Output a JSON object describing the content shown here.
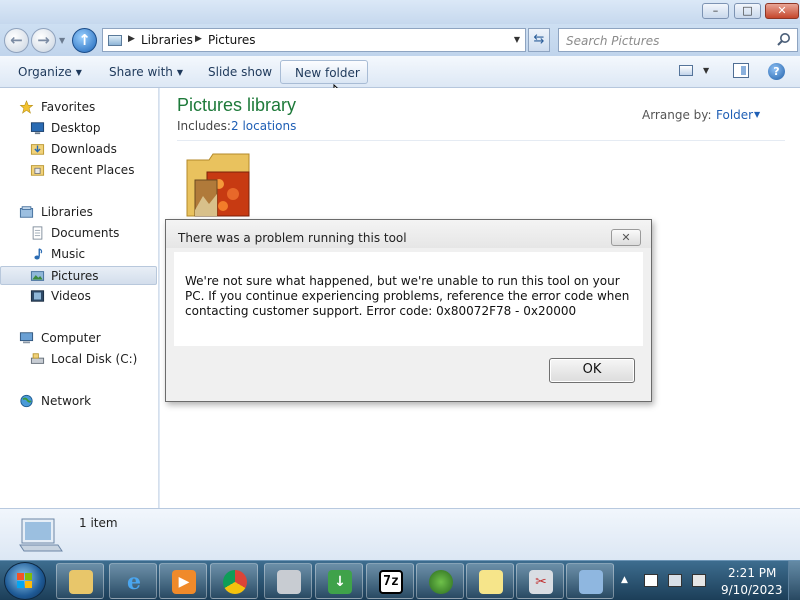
{
  "window": {
    "minimize_label": "–",
    "maximize_label": "□",
    "close_label": "✕"
  },
  "address": {
    "breadcrumb": [
      "Libraries",
      "Pictures"
    ],
    "search_placeholder": "Search Pictures"
  },
  "toolbar": {
    "organize": "Organize",
    "share_with": "Share with",
    "slide_show": "Slide show",
    "new_folder": "New folder"
  },
  "nav": {
    "favorites": "Favorites",
    "desktop": "Desktop",
    "downloads": "Downloads",
    "recent_places": "Recent Places",
    "libraries": "Libraries",
    "documents": "Documents",
    "music": "Music",
    "pictures": "Pictures",
    "videos": "Videos",
    "computer": "Computer",
    "local_disk": "Local Disk (C:)",
    "network": "Network"
  },
  "content": {
    "title": "Pictures library",
    "includes_label": "Includes:",
    "locations_link": "2 locations",
    "arrange_label": "Arrange by:",
    "arrange_value": "Folder"
  },
  "details": {
    "item_count": "1 item"
  },
  "dialog": {
    "title": "There was a problem running this tool",
    "message": "We're not sure what happened, but we're unable to run this tool on your PC. If you continue experiencing problems, reference the error code when contacting customer support. Error code: 0x80072F78 - 0x20000",
    "ok_label": "OK"
  },
  "taskbar": {
    "apps": [
      "windows-explorer",
      "internet-explorer",
      "media-player",
      "chrome",
      "scanner",
      "download-tool",
      "7zip",
      "media-creation-tool",
      "sticky-notes",
      "snipping-tool",
      "remote-desktop"
    ],
    "seven_zip_label": "7z",
    "clock_time": "2:21 PM",
    "clock_date": "9/10/2023"
  },
  "colors": {
    "library_title": "#1e7a3a",
    "link_blue": "#1f5fb5",
    "taskbar": "#1c3e58"
  }
}
